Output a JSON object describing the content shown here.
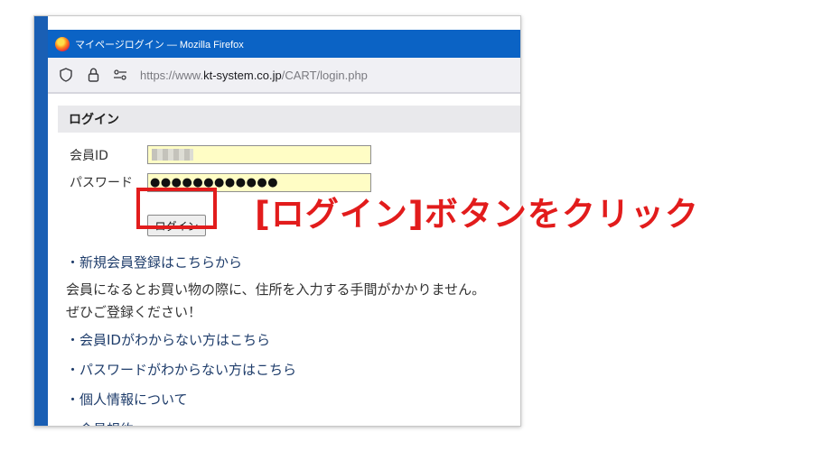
{
  "window": {
    "title": "マイページログイン — Mozilla Firefox"
  },
  "urlbar": {
    "url_prefix": "https://www.",
    "url_host": "kt-system.co.jp",
    "url_path": "/CART/login.php"
  },
  "page": {
    "heading": "ログイン",
    "member_id_label": "会員ID",
    "password_label": "パスワード",
    "password_value": "●●●●●●●●●●●●",
    "login_button": "ログイン",
    "links": {
      "register": "・新規会員登録はこちらから",
      "forgot_id": "・会員IDがわからない方はこちら",
      "forgot_password": "・パスワードがわからない方はこちら",
      "privacy": "・個人情報について",
      "terms": "・会員規約"
    },
    "register_note_line1": "会員になるとお買い物の際に、住所を入力する手間がかかりません。",
    "register_note_line2": "ぜひご登録ください！"
  },
  "annotation": {
    "text": "[ログイン]ボタンをクリック",
    "color": "#e21c1c"
  },
  "icons": [
    "firefox-logo-icon",
    "shield-icon",
    "lock-icon",
    "permissions-icon"
  ]
}
